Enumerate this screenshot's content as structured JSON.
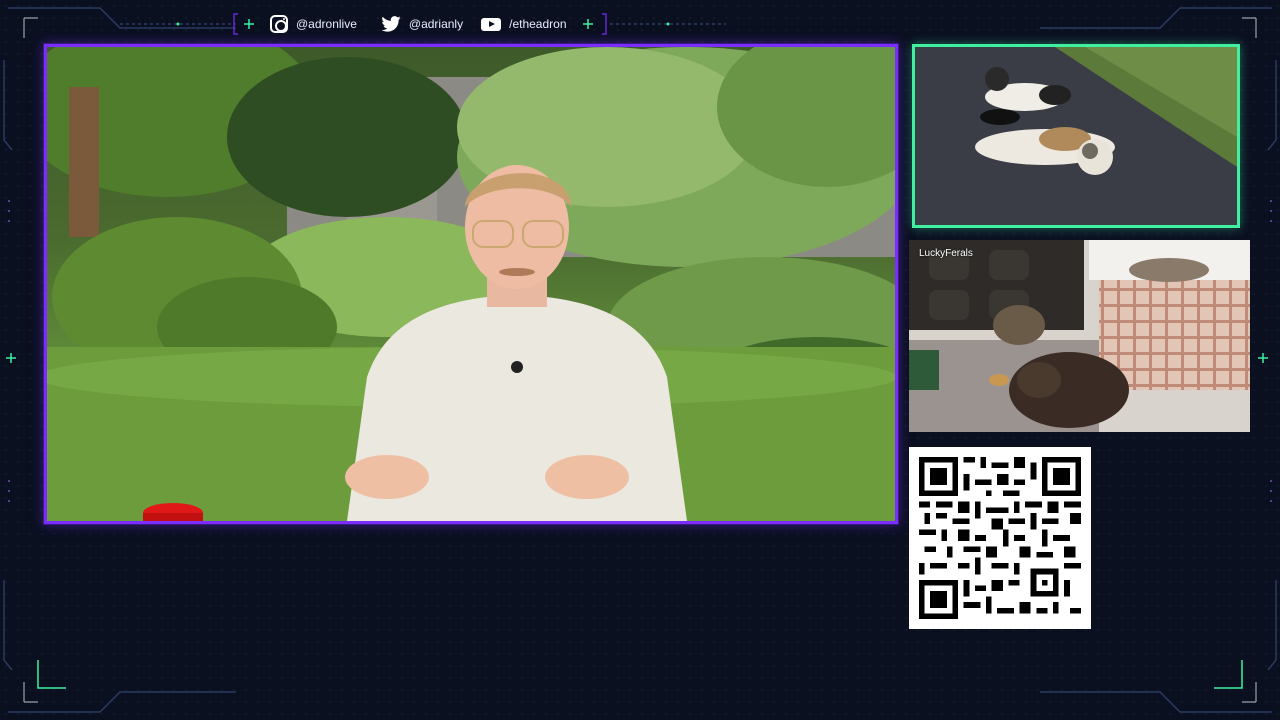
{
  "social": {
    "instagram": "@adronlive",
    "twitter": "@adrianly",
    "youtube": "/etheadron"
  },
  "cams": {
    "lower_label": "LuckyFerals"
  },
  "colors": {
    "main_border": "#7b2cff",
    "cam_border": "#3ef0a0",
    "frame_accent": "#2a3a60",
    "background": "#0b1020"
  },
  "icons": {
    "instagram": "instagram-icon",
    "twitter": "twitter-icon",
    "youtube": "youtube-icon"
  }
}
